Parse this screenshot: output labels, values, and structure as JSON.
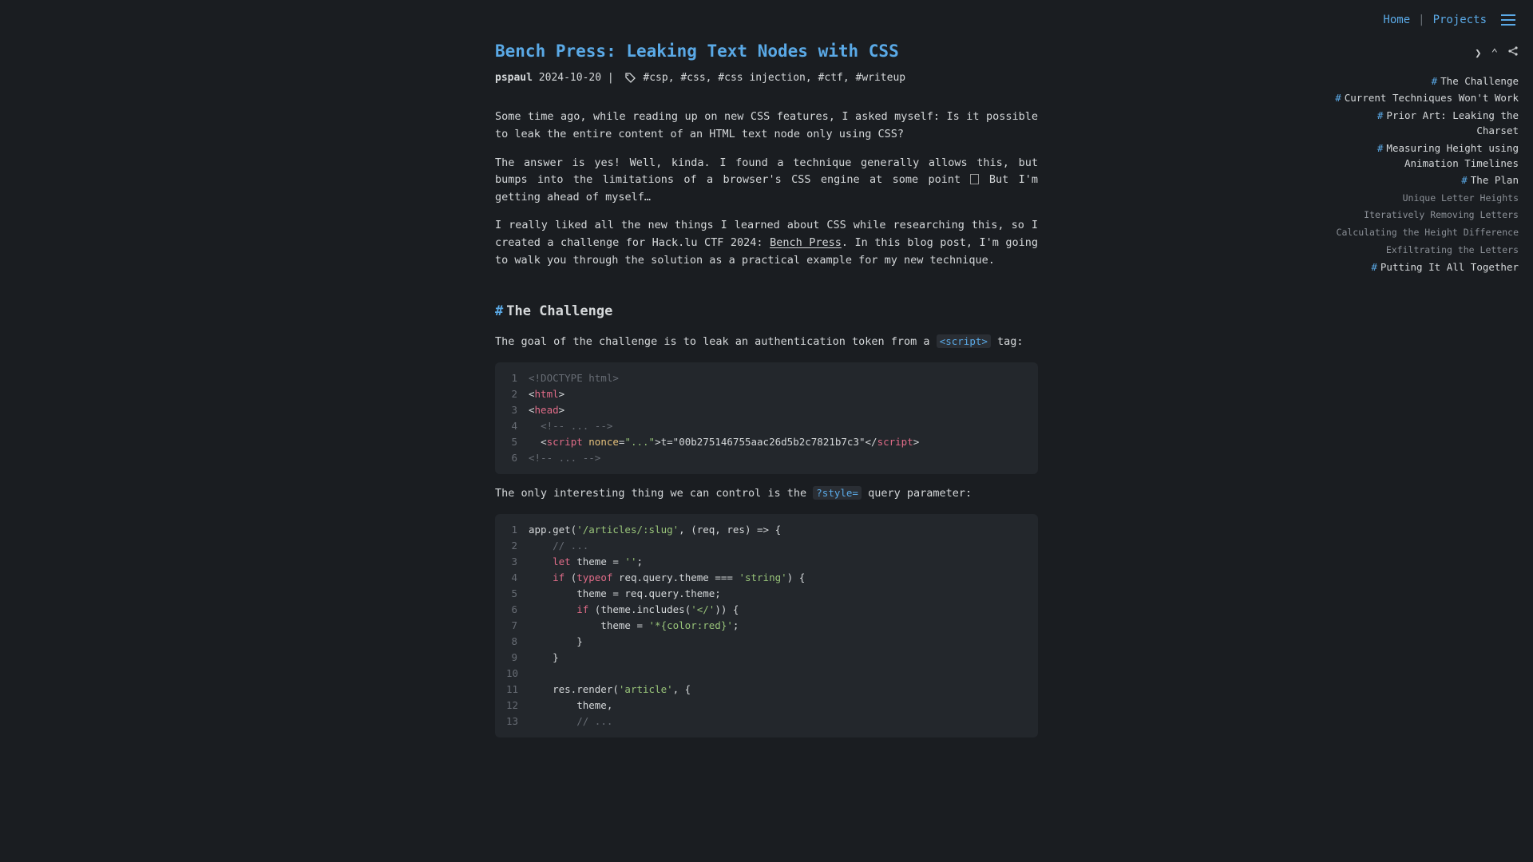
{
  "nav": {
    "home": "Home",
    "projects": "Projects",
    "sep": "|"
  },
  "title": "Bench Press: Leaking Text Nodes with CSS",
  "meta": {
    "author": "pspaul",
    "date": "2024-10-20",
    "sep": " | ",
    "tags": "#csp, #css, #css injection, #ctf, #writeup"
  },
  "p1": "Some time ago, while reading up on new CSS features, I asked myself: Is it possible to leak the entire content of an HTML text node only using CSS?",
  "p2a": "The answer is yes! Well, kinda. I found a technique generally allows this, but bumps into the limitations of a browser's CSS engine at some point ",
  "p2b": " But I'm getting ahead of myself…",
  "p3a": "I really liked all the new things I learned about CSS while researching this, so I created a challenge for Hack.lu CTF 2024: ",
  "p3link": "Bench Press",
  "p3b": ". In this blog post, I'm going to walk you through the solution as a practical example for my new technique.",
  "h_challenge": "The Challenge",
  "p4a": "The goal of the challenge is to leak an authentication token from a ",
  "p4code": "<script>",
  "p4b": " tag:",
  "code1": [
    {
      "n": "1",
      "seg": [
        {
          "cls": "c-comment",
          "t": "<!DOCTYPE html>"
        }
      ]
    },
    {
      "n": "2",
      "seg": [
        {
          "cls": "c-punct",
          "t": "<"
        },
        {
          "cls": "c-tag",
          "t": "html"
        },
        {
          "cls": "c-punct",
          "t": ">"
        }
      ]
    },
    {
      "n": "3",
      "seg": [
        {
          "cls": "c-punct",
          "t": "<"
        },
        {
          "cls": "c-tag",
          "t": "head"
        },
        {
          "cls": "c-punct",
          "t": ">"
        }
      ]
    },
    {
      "n": "4",
      "seg": [
        {
          "cls": "",
          "t": "  "
        },
        {
          "cls": "c-comment",
          "t": "<!-- ... -->"
        }
      ]
    },
    {
      "n": "5",
      "seg": [
        {
          "cls": "",
          "t": "  "
        },
        {
          "cls": "c-punct",
          "t": "<"
        },
        {
          "cls": "c-tag",
          "t": "script"
        },
        {
          "cls": "",
          "t": " "
        },
        {
          "cls": "c-attr",
          "t": "nonce"
        },
        {
          "cls": "c-punct",
          "t": "="
        },
        {
          "cls": "c-str",
          "t": "\"...\""
        },
        {
          "cls": "c-punct",
          "t": ">"
        },
        {
          "cls": "",
          "t": "t=\"00b275146755aac26d5b2c7821b7c3\""
        },
        {
          "cls": "c-punct",
          "t": "</"
        },
        {
          "cls": "c-tag",
          "t": "script"
        },
        {
          "cls": "c-punct",
          "t": ">"
        }
      ]
    },
    {
      "n": "6",
      "seg": [
        {
          "cls": "c-comment",
          "t": "<!-- ... -->"
        }
      ]
    }
  ],
  "p5a": "The only interesting thing we can control is the ",
  "p5code": "?style=",
  "p5b": " query parameter:",
  "code2": [
    {
      "n": "1",
      "seg": [
        {
          "cls": "",
          "t": "app.get("
        },
        {
          "cls": "c-str",
          "t": "'/articles/:slug'"
        },
        {
          "cls": "",
          "t": ", (req, res) => {"
        }
      ]
    },
    {
      "n": "2",
      "seg": [
        {
          "cls": "",
          "t": "    "
        },
        {
          "cls": "c-comment",
          "t": "// ..."
        }
      ]
    },
    {
      "n": "3",
      "seg": [
        {
          "cls": "",
          "t": "    "
        },
        {
          "cls": "c-kw",
          "t": "let"
        },
        {
          "cls": "",
          "t": " theme = "
        },
        {
          "cls": "c-str",
          "t": "''"
        },
        {
          "cls": "",
          "t": ";"
        }
      ]
    },
    {
      "n": "4",
      "seg": [
        {
          "cls": "",
          "t": "    "
        },
        {
          "cls": "c-kw",
          "t": "if"
        },
        {
          "cls": "",
          "t": " ("
        },
        {
          "cls": "c-kw",
          "t": "typeof"
        },
        {
          "cls": "",
          "t": " req.query.theme === "
        },
        {
          "cls": "c-str",
          "t": "'string'"
        },
        {
          "cls": "",
          "t": ") {"
        }
      ]
    },
    {
      "n": "5",
      "seg": [
        {
          "cls": "",
          "t": "        theme = req.query.theme;"
        }
      ]
    },
    {
      "n": "6",
      "seg": [
        {
          "cls": "",
          "t": "        "
        },
        {
          "cls": "c-kw",
          "t": "if"
        },
        {
          "cls": "",
          "t": " (theme.includes("
        },
        {
          "cls": "c-str",
          "t": "'</'"
        },
        {
          "cls": "",
          "t": ")) {"
        }
      ]
    },
    {
      "n": "7",
      "seg": [
        {
          "cls": "",
          "t": "            theme = "
        },
        {
          "cls": "c-str",
          "t": "'*{color:red}'"
        },
        {
          "cls": "",
          "t": ";"
        }
      ]
    },
    {
      "n": "8",
      "seg": [
        {
          "cls": "",
          "t": "        }"
        }
      ]
    },
    {
      "n": "9",
      "seg": [
        {
          "cls": "",
          "t": "    }"
        }
      ]
    },
    {
      "n": "10",
      "seg": [
        {
          "cls": "",
          "t": ""
        }
      ]
    },
    {
      "n": "11",
      "seg": [
        {
          "cls": "",
          "t": "    res.render("
        },
        {
          "cls": "c-str",
          "t": "'article'"
        },
        {
          "cls": "",
          "t": ", {"
        }
      ]
    },
    {
      "n": "12",
      "seg": [
        {
          "cls": "",
          "t": "        theme,"
        }
      ]
    },
    {
      "n": "13",
      "seg": [
        {
          "cls": "",
          "t": "        "
        },
        {
          "cls": "c-comment",
          "t": "// ..."
        }
      ]
    }
  ],
  "toc": [
    {
      "type": "main",
      "label": "The Challenge"
    },
    {
      "type": "main",
      "label": "Current Techniques Won't Work"
    },
    {
      "type": "main",
      "label": "Prior Art: Leaking the Charset"
    },
    {
      "type": "main",
      "label": "Measuring Height using Animation Timelines"
    },
    {
      "type": "main",
      "label": "The Plan"
    },
    {
      "type": "sub",
      "label": "Unique Letter Heights"
    },
    {
      "type": "sub",
      "label": "Iteratively Removing Letters"
    },
    {
      "type": "sub",
      "label": "Calculating the Height Difference"
    },
    {
      "type": "sub",
      "label": "Exfiltrating the Letters"
    },
    {
      "type": "main",
      "label": "Putting It All Together"
    }
  ]
}
